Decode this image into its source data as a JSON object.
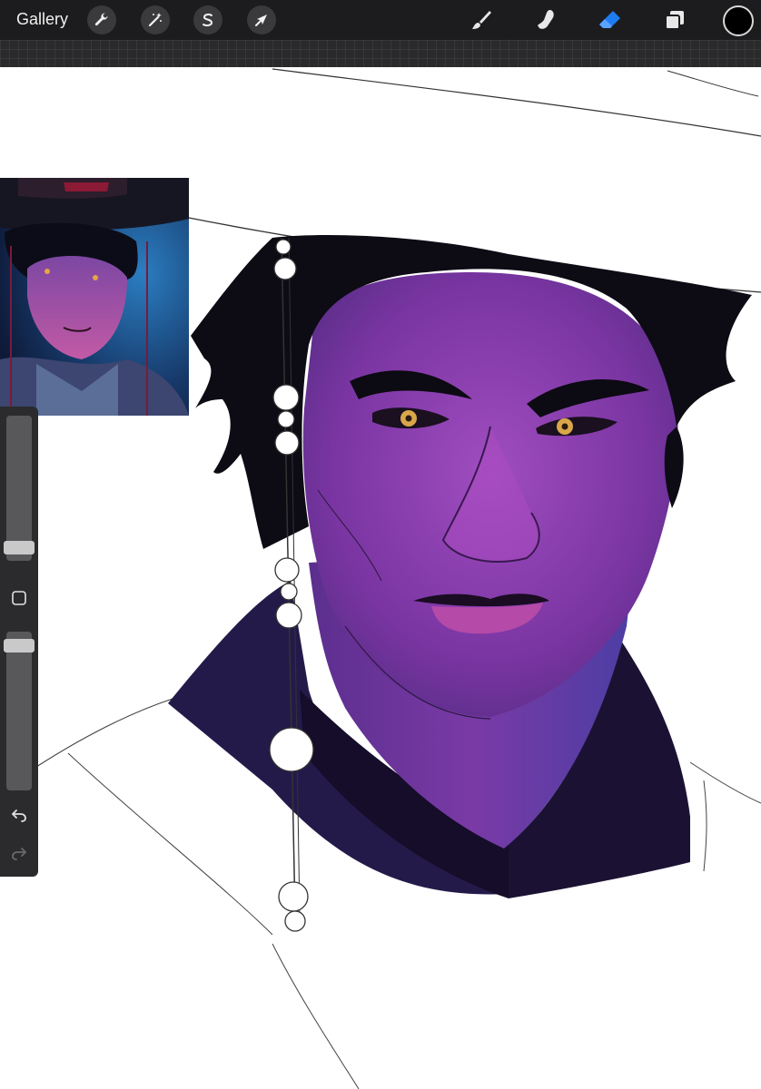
{
  "toolbar": {
    "gallery_label": "Gallery",
    "left_tools": [
      {
        "name": "actions",
        "icon": "wrench-icon"
      },
      {
        "name": "adjustments",
        "icon": "magic-wand-icon"
      },
      {
        "name": "selection",
        "icon": "selection-s-icon"
      },
      {
        "name": "transform",
        "icon": "arrow-cursor-icon"
      }
    ],
    "right_tools": [
      {
        "name": "brush",
        "icon": "brush-icon",
        "active": false
      },
      {
        "name": "smudge",
        "icon": "smudge-finger-icon",
        "active": false
      },
      {
        "name": "eraser",
        "icon": "eraser-icon",
        "active": true
      },
      {
        "name": "layers",
        "icon": "layers-icon",
        "active": false
      }
    ],
    "current_color": "#000000",
    "active_tool_color": "#1e7cf2"
  },
  "sidebar": {
    "brush_size_level": 0.05,
    "brush_opacity_level": 0.95,
    "modify_button_icon": "square-icon",
    "undo_icon": "undo-icon",
    "redo_icon": "redo-icon"
  },
  "artwork": {
    "skin_color": "#8a3fb0",
    "hair_color": "#0d0b14",
    "collar_color": "#1b1233",
    "reference_background": "#16284f"
  }
}
